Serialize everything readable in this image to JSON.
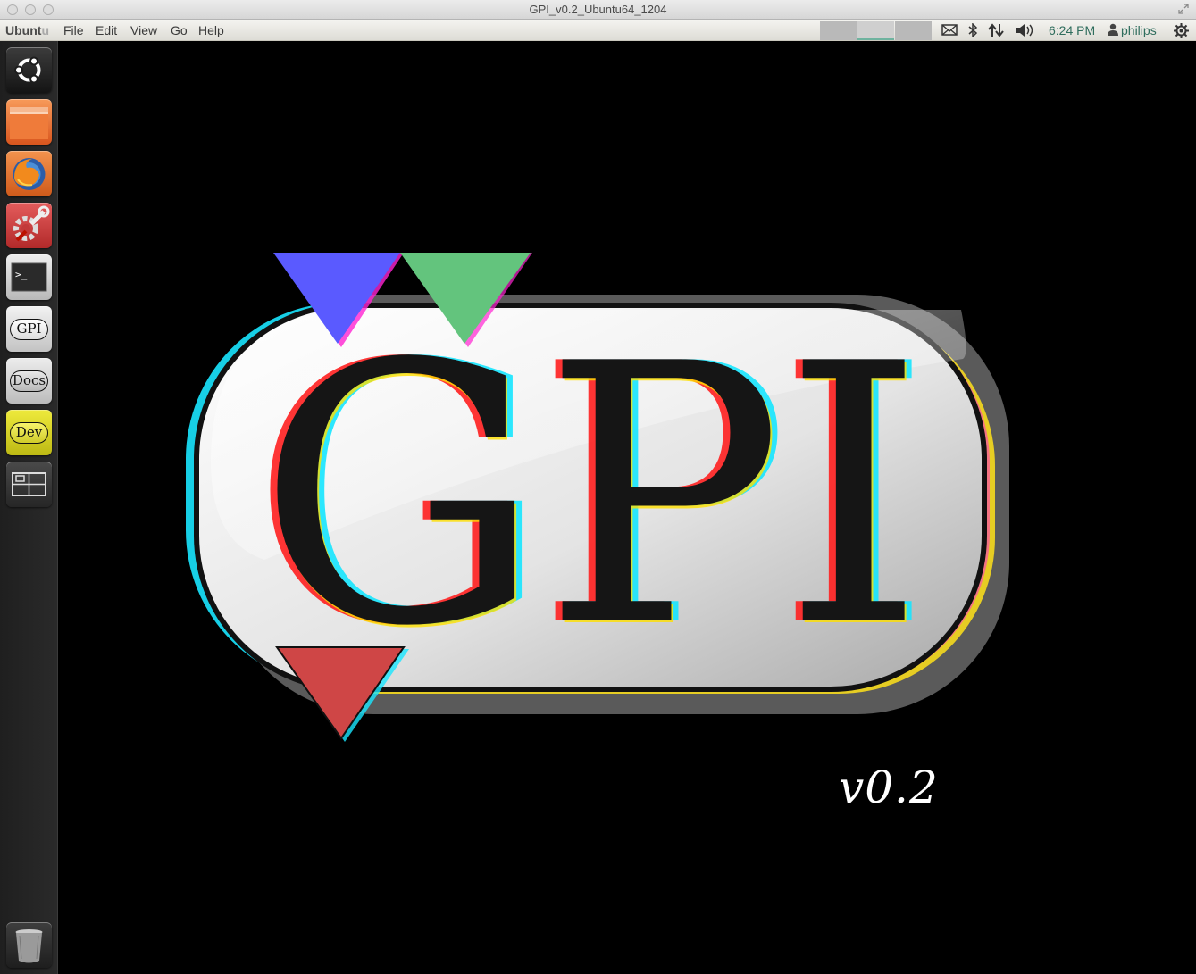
{
  "window": {
    "title": "GPI_v0.2_Ubuntu64_1204"
  },
  "panel": {
    "app_name_main": "Ubunt",
    "app_name_tail": "u",
    "menus": [
      "File",
      "Edit",
      "View",
      "Go",
      "Help"
    ],
    "clock": "6:24 PM",
    "user": "philips",
    "indicators": [
      "mail-icon",
      "bluetooth-icon",
      "network-icon",
      "volume-icon",
      "session-gear-icon"
    ]
  },
  "launcher": {
    "items": [
      {
        "name": "dash-home",
        "icon": "ubuntu-logo-icon"
      },
      {
        "name": "files",
        "icon": "folder-icon"
      },
      {
        "name": "firefox",
        "icon": "firefox-icon"
      },
      {
        "name": "system-settings",
        "icon": "settings-tools-icon"
      },
      {
        "name": "terminal",
        "icon": "terminal-icon",
        "label": ">_"
      },
      {
        "name": "gpi",
        "icon": "gpi-app-icon",
        "label": "GPI"
      },
      {
        "name": "docs",
        "icon": "docs-app-icon",
        "label": "Docs"
      },
      {
        "name": "dev",
        "icon": "dev-app-icon",
        "label": "Dev"
      },
      {
        "name": "workspace-switcher",
        "icon": "workspace-switcher-icon"
      },
      {
        "name": "trash",
        "icon": "trash-icon"
      }
    ]
  },
  "splash": {
    "logo_text": "GPI",
    "version": "v0.2",
    "colors": {
      "blue": "#5a5aff",
      "green": "#5fc07a",
      "red": "#d04545"
    }
  }
}
